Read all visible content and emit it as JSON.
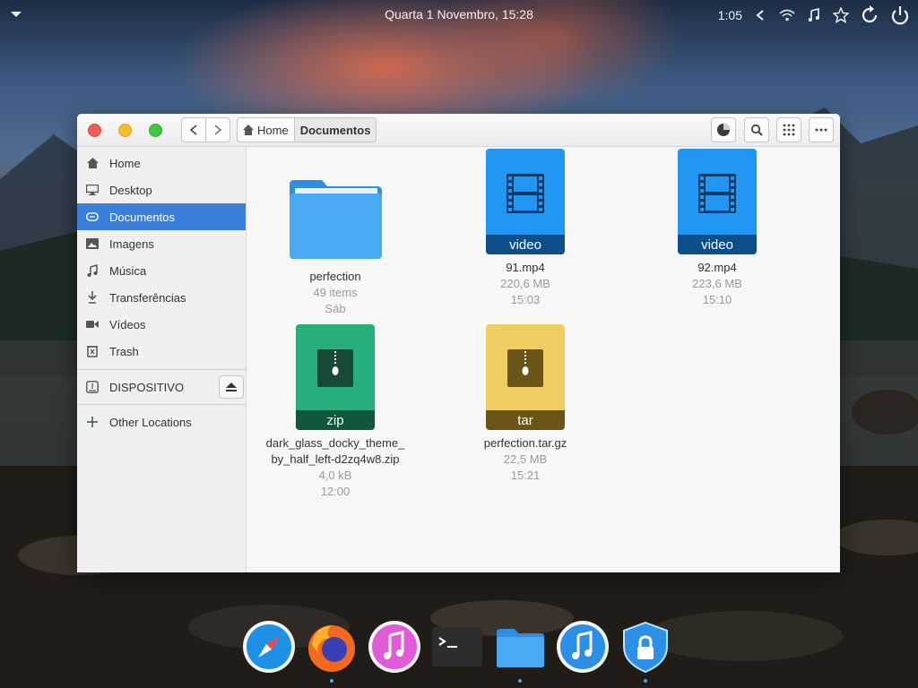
{
  "topbar": {
    "clock": "Quarta  1 Novembro, 15:28",
    "battery_time": "1:05"
  },
  "window": {
    "breadcrumb": {
      "home_label": "Home",
      "current_label": "Documentos"
    },
    "sidebar": {
      "items": [
        {
          "label": "Home",
          "icon": "home-icon"
        },
        {
          "label": "Desktop",
          "icon": "desktop-icon"
        },
        {
          "label": "Documentos",
          "icon": "documents-icon",
          "selected": true
        },
        {
          "label": "Imagens",
          "icon": "pictures-icon"
        },
        {
          "label": "Música",
          "icon": "music-icon"
        },
        {
          "label": "Transferências",
          "icon": "downloads-icon"
        },
        {
          "label": "Vídeos",
          "icon": "videos-icon"
        },
        {
          "label": "Trash",
          "icon": "trash-icon"
        }
      ],
      "device_label": "DISPOSITIVO",
      "other_locations_label": "Other Locations"
    },
    "files": [
      {
        "name": "perfection",
        "size": "49 items",
        "date": "Sáb",
        "type": "folder"
      },
      {
        "name": "91.mp4",
        "size": "220,6 MB",
        "date": "15:03",
        "type": "video",
        "badge": "video"
      },
      {
        "name": "92.mp4",
        "size": "223,6 MB",
        "date": "15:10",
        "type": "video",
        "badge": "video"
      },
      {
        "name": "dark_glass_docky_theme_\nby_half_left-d2zq4w8.zip",
        "size": "4,0 kB",
        "date": "12:00",
        "type": "zip",
        "badge": "zip"
      },
      {
        "name": "perfection.tar.gz",
        "size": "22,5 MB",
        "date": "15:21",
        "type": "tar",
        "badge": "tar"
      }
    ]
  },
  "dock": {
    "apps": [
      "safari-icon",
      "firefox-icon",
      "itunes-icon",
      "terminal-icon",
      "files-icon",
      "music-icon",
      "vpn-lock-icon"
    ]
  },
  "colors": {
    "accent": "#3a7fdb",
    "video_blue": "#2196f3",
    "zip_green": "#27ae7a",
    "tar_yellow": "#f0cd62"
  }
}
